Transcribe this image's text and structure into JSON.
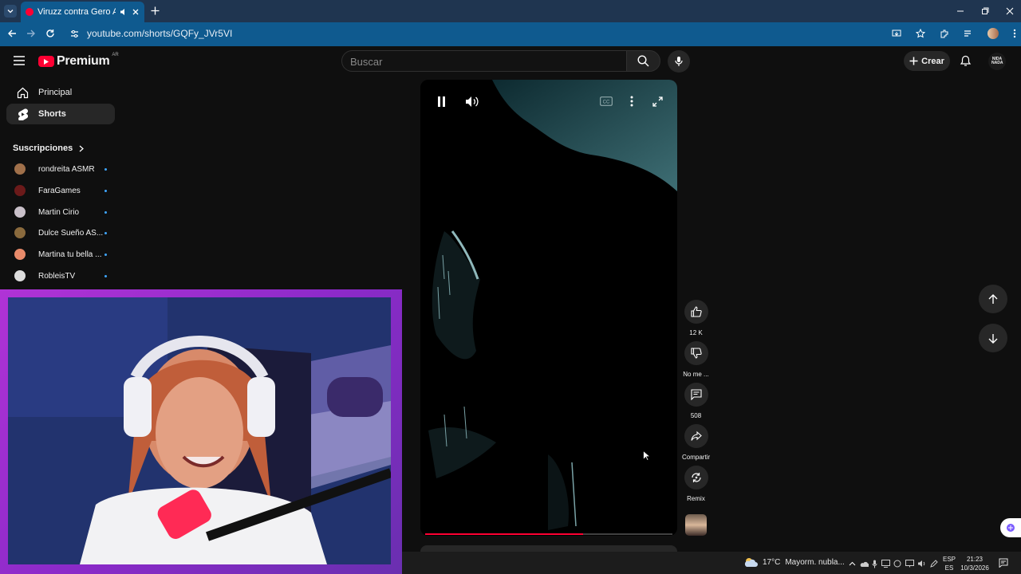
{
  "browser": {
    "tab_title": "Viruzz contra Gero Arias en",
    "url": "youtube.com/shorts/GQFy_JVr5VI"
  },
  "header": {
    "logo_text": "Premium",
    "logo_badge": "AR",
    "search_placeholder": "Buscar",
    "create_label": "Crear",
    "avatar_text": "NIDA NADA"
  },
  "sidebar": {
    "items": [
      {
        "label": "Principal",
        "icon": "home-icon"
      },
      {
        "label": "Shorts",
        "icon": "shorts-icon"
      }
    ],
    "subs_title": "Suscripciones",
    "subscriptions": [
      {
        "name": "rondreita ASMR",
        "color": "#a0704a"
      },
      {
        "name": "FaraGames",
        "color": "#6b1a1a"
      },
      {
        "name": "Martin Cirio",
        "color": "#c9c0c9"
      },
      {
        "name": "Dulce Sueño AS...",
        "color": "#8a6a3d"
      },
      {
        "name": "Martina tu bella ...",
        "color": "#e88a6a"
      },
      {
        "name": "RobleisTV",
        "color": "#dddddd"
      }
    ]
  },
  "actions": {
    "likes": "12 K",
    "dislike": "No me ...",
    "comments": "508",
    "share": "Compartir",
    "remix": "Remix"
  },
  "video": {
    "progress": 0.64
  },
  "taskbar": {
    "weather_temp": "17°C",
    "weather_text": "Mayorm. nubla...",
    "lang_top": "ESP",
    "lang_bottom": "ES",
    "time": "21:23",
    "date": "10/3/2026"
  },
  "colors": {
    "brand_red": "#ff0033",
    "accent_blue": "#3ea6ff",
    "chrome_blue": "#0f5a8f",
    "overlay_purple": "#b033d6"
  }
}
